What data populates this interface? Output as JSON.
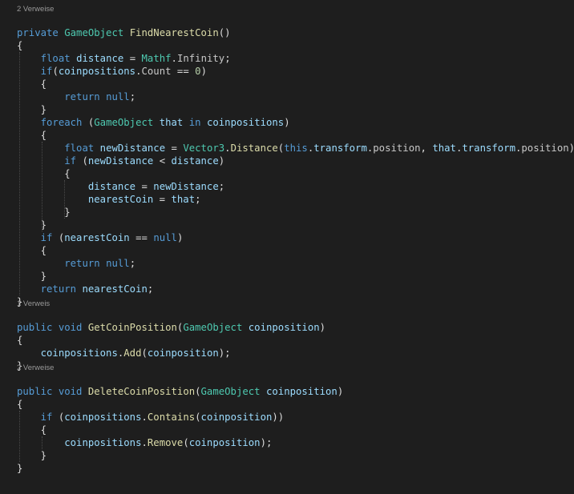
{
  "editor": {
    "codelens": [
      {
        "line": 0,
        "text": "2 Verweise"
      },
      {
        "line": 23,
        "text": "1 Verweis"
      },
      {
        "line": 28,
        "text": "2 Verweise"
      }
    ],
    "lines": [
      [],
      [
        [
          "k",
          "private"
        ],
        [
          "p",
          " "
        ],
        [
          "t",
          "GameObject"
        ],
        [
          "p",
          " "
        ],
        [
          "m",
          "FindNearestCoin"
        ],
        [
          "p",
          "()"
        ]
      ],
      [
        [
          "p",
          "{"
        ]
      ],
      [
        [
          "p",
          "    "
        ],
        [
          "k",
          "float"
        ],
        [
          "p",
          " "
        ],
        [
          "v",
          "distance"
        ],
        [
          "p",
          " = "
        ],
        [
          "t",
          "Mathf"
        ],
        [
          "p",
          "."
        ],
        [
          "pl",
          "Infinity"
        ],
        [
          "p",
          ";"
        ]
      ],
      [
        [
          "p",
          "    "
        ],
        [
          "k",
          "if"
        ],
        [
          "p",
          "("
        ],
        [
          "v",
          "coinpositions"
        ],
        [
          "p",
          "."
        ],
        [
          "pl",
          "Count"
        ],
        [
          "p",
          " == "
        ],
        [
          "n",
          "0"
        ],
        [
          "p",
          ")"
        ]
      ],
      [
        [
          "p",
          "    {"
        ]
      ],
      [
        [
          "p",
          "        "
        ],
        [
          "k",
          "return"
        ],
        [
          "p",
          " "
        ],
        [
          "k",
          "null"
        ],
        [
          "p",
          ";"
        ]
      ],
      [
        [
          "p",
          "    }"
        ]
      ],
      [
        [
          "p",
          "    "
        ],
        [
          "k",
          "foreach"
        ],
        [
          "p",
          " ("
        ],
        [
          "t",
          "GameObject"
        ],
        [
          "p",
          " "
        ],
        [
          "v",
          "that"
        ],
        [
          "p",
          " "
        ],
        [
          "k",
          "in"
        ],
        [
          "p",
          " "
        ],
        [
          "v",
          "coinpositions"
        ],
        [
          "p",
          ")"
        ]
      ],
      [
        [
          "p",
          "    {"
        ]
      ],
      [
        [
          "p",
          "        "
        ],
        [
          "k",
          "float"
        ],
        [
          "p",
          " "
        ],
        [
          "v",
          "newDistance"
        ],
        [
          "p",
          " = "
        ],
        [
          "t",
          "Vector3"
        ],
        [
          "p",
          "."
        ],
        [
          "m",
          "Distance"
        ],
        [
          "p",
          "("
        ],
        [
          "k",
          "this"
        ],
        [
          "p",
          "."
        ],
        [
          "v",
          "transform"
        ],
        [
          "p",
          "."
        ],
        [
          "pl",
          "position"
        ],
        [
          "p",
          ", "
        ],
        [
          "v",
          "that"
        ],
        [
          "p",
          "."
        ],
        [
          "v",
          "transform"
        ],
        [
          "p",
          "."
        ],
        [
          "pl",
          "position"
        ],
        [
          "p",
          ");"
        ]
      ],
      [
        [
          "p",
          "        "
        ],
        [
          "k",
          "if"
        ],
        [
          "p",
          " ("
        ],
        [
          "v",
          "newDistance"
        ],
        [
          "p",
          " < "
        ],
        [
          "v",
          "distance"
        ],
        [
          "p",
          ")"
        ]
      ],
      [
        [
          "p",
          "        {"
        ]
      ],
      [
        [
          "p",
          "            "
        ],
        [
          "v",
          "distance"
        ],
        [
          "p",
          " = "
        ],
        [
          "v",
          "newDistance"
        ],
        [
          "p",
          ";"
        ]
      ],
      [
        [
          "p",
          "            "
        ],
        [
          "v",
          "nearestCoin"
        ],
        [
          "p",
          " = "
        ],
        [
          "v",
          "that"
        ],
        [
          "p",
          ";"
        ]
      ],
      [
        [
          "p",
          "        }"
        ]
      ],
      [
        [
          "p",
          "    }"
        ]
      ],
      [
        [
          "p",
          "    "
        ],
        [
          "k",
          "if"
        ],
        [
          "p",
          " ("
        ],
        [
          "v",
          "nearestCoin"
        ],
        [
          "p",
          " == "
        ],
        [
          "k",
          "null"
        ],
        [
          "p",
          ")"
        ]
      ],
      [
        [
          "p",
          "    {"
        ]
      ],
      [
        [
          "p",
          "        "
        ],
        [
          "k",
          "return"
        ],
        [
          "p",
          " "
        ],
        [
          "k",
          "null"
        ],
        [
          "p",
          ";"
        ]
      ],
      [
        [
          "p",
          "    }"
        ]
      ],
      [
        [
          "p",
          "    "
        ],
        [
          "k",
          "return"
        ],
        [
          "p",
          " "
        ],
        [
          "v",
          "nearestCoin"
        ],
        [
          "p",
          ";"
        ]
      ],
      [
        [
          "p",
          "}"
        ]
      ],
      [],
      [
        [
          "k",
          "public"
        ],
        [
          "p",
          " "
        ],
        [
          "k",
          "void"
        ],
        [
          "p",
          " "
        ],
        [
          "m",
          "GetCoinPosition"
        ],
        [
          "p",
          "("
        ],
        [
          "t",
          "GameObject"
        ],
        [
          "p",
          " "
        ],
        [
          "v",
          "coinposition"
        ],
        [
          "p",
          ")"
        ]
      ],
      [
        [
          "p",
          "{"
        ]
      ],
      [
        [
          "p",
          "    "
        ],
        [
          "v",
          "coinpositions"
        ],
        [
          "p",
          "."
        ],
        [
          "m",
          "Add"
        ],
        [
          "p",
          "("
        ],
        [
          "v",
          "coinposition"
        ],
        [
          "p",
          ");"
        ]
      ],
      [
        [
          "p",
          "}"
        ]
      ],
      [],
      [
        [
          "k",
          "public"
        ],
        [
          "p",
          " "
        ],
        [
          "k",
          "void"
        ],
        [
          "p",
          " "
        ],
        [
          "m",
          "DeleteCoinPosition"
        ],
        [
          "p",
          "("
        ],
        [
          "t",
          "GameObject"
        ],
        [
          "p",
          " "
        ],
        [
          "v",
          "coinposition"
        ],
        [
          "p",
          ")"
        ]
      ],
      [
        [
          "p",
          "{"
        ]
      ],
      [
        [
          "p",
          "    "
        ],
        [
          "k",
          "if"
        ],
        [
          "p",
          " ("
        ],
        [
          "v",
          "coinpositions"
        ],
        [
          "p",
          "."
        ],
        [
          "m",
          "Contains"
        ],
        [
          "p",
          "("
        ],
        [
          "v",
          "coinposition"
        ],
        [
          "p",
          "))"
        ]
      ],
      [
        [
          "p",
          "    {"
        ]
      ],
      [
        [
          "p",
          "        "
        ],
        [
          "v",
          "coinpositions"
        ],
        [
          "p",
          "."
        ],
        [
          "m",
          "Remove"
        ],
        [
          "p",
          "("
        ],
        [
          "v",
          "coinposition"
        ],
        [
          "p",
          ");"
        ]
      ],
      [
        [
          "p",
          "    }"
        ]
      ],
      [
        [
          "p",
          "}"
        ]
      ]
    ]
  }
}
